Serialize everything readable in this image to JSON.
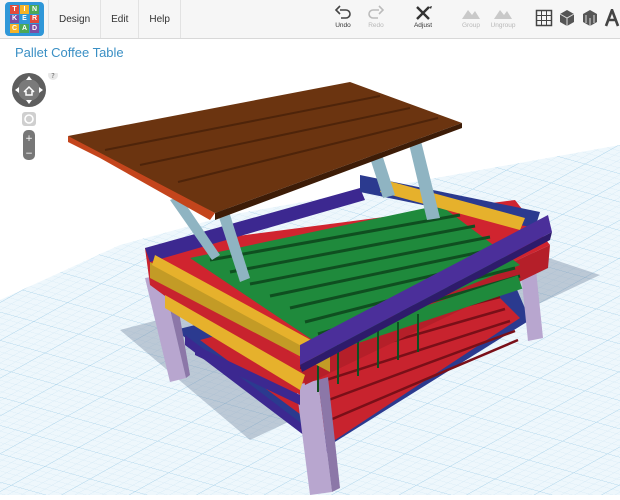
{
  "logo_letters": [
    "T",
    "I",
    "N",
    "K",
    "E",
    "R",
    "C",
    "A",
    "D"
  ],
  "logo_colors": [
    "#e24b3b",
    "#f6b327",
    "#4da855",
    "#7c4fa3",
    "#2f97d8",
    "#e24b3b",
    "#f6b327",
    "#4da855",
    "#7c4fa3"
  ],
  "menu": {
    "design": "Design",
    "edit": "Edit",
    "help": "Help"
  },
  "tools": {
    "undo": "Undo",
    "redo": "Redo",
    "adjust": "Adjust",
    "group": "Group",
    "ungroup": "Ungroup"
  },
  "project_title": "Pallet Coffee Table",
  "nav": {
    "help": "?",
    "zoom_in": "+",
    "zoom_out": "−"
  },
  "colors": {
    "accent": "#2f97d8",
    "grid": "#cfe6f3"
  }
}
